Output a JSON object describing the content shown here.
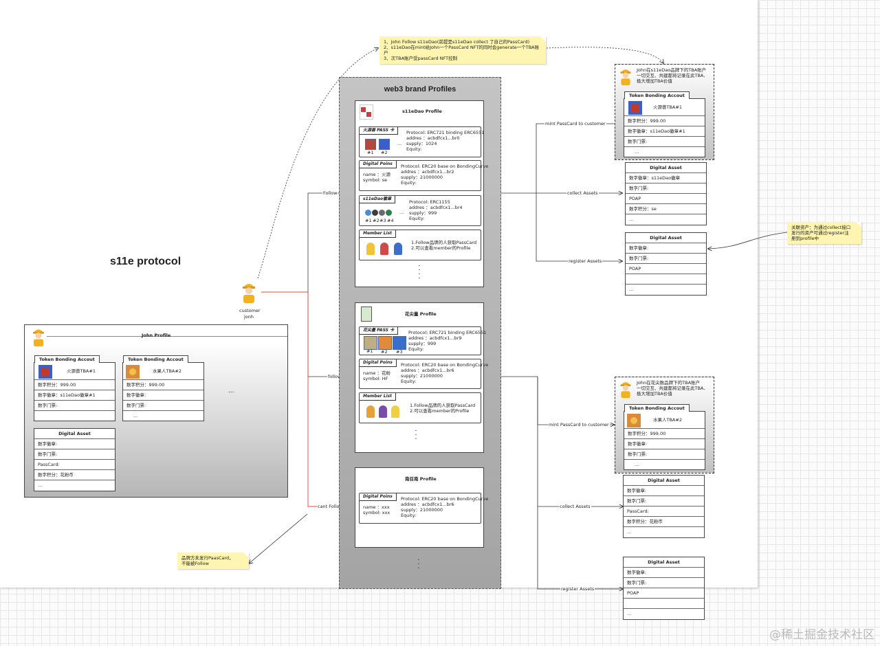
{
  "title": "s11e protocol",
  "profiles_title": "web3 brand Profiles",
  "customer": {
    "label1": "customer",
    "label2": "jonh"
  },
  "top_note": [
    "1、John Follow s11eDao(前提是s11eDao collect 了自己的PassCard)",
    "2、s11eDao在mint给John一个PassCard NFT的同时会generate一个TBA账户",
    "3、次TBA账户受passCard NFT控制"
  ],
  "bottom_note": [
    "品牌方未发行PaasCard，",
    "不能被Follow"
  ],
  "right_note": [
    "关联资产：为通过collect接口",
    "发行的资产可通过register注",
    "册到profile中"
  ],
  "edges": {
    "follow1": "Follow",
    "follow2": "follow",
    "cant": "cant Follow",
    "mint1": "mint PassCard to customer",
    "collect1": "collect Assets",
    "register1": "register Assets",
    "mint2": "mint PassCard to customer",
    "collect2": "collect Assets",
    "register2": "register Assets"
  },
  "john": {
    "title": "John Profile",
    "tba1": {
      "head": "Token Bonding Accout",
      "name": "火源兽TBA#1",
      "rows": [
        "数字积分：999.00",
        "数字徽章：s11eDao徽章#1",
        "数字门票:",
        ""
      ]
    },
    "tba2": {
      "head": "Token Bonding Accout",
      "name": "水果人TBA#2",
      "rows": [
        "数字积分：999.00",
        "数字徽章:",
        "数字门票:",
        "..."
      ]
    },
    "more": "...",
    "asset": {
      "head": "Digital Asset",
      "rows": [
        "数字徽章:",
        "数字门票:",
        "PassCard:",
        "数字积分：花粉币",
        "..."
      ]
    }
  },
  "s11e": {
    "title": "s11eDao Profile",
    "pass": {
      "tab": "火源兽 PASS 卡",
      "n1": "#1",
      "n2": "#2",
      "more": "...",
      "lines": [
        "Protocol: ERC721 binding ERC6551",
        "addres ：acbdfcx1...br0",
        "supply：1024",
        "Equity:"
      ]
    },
    "points": {
      "tab": "Digital Poins",
      "left": [
        "name ：火源",
        "symbol:  se"
      ],
      "lines": [
        "Protocol: ERC20 base on BondingCurve",
        "addres ：acbdfcx1...br2",
        "supply：21000000",
        "Equity:"
      ]
    },
    "badge": {
      "tab": "s11eDao徽章",
      "nums": [
        "#1",
        "#2",
        "#3",
        "#4"
      ],
      "more": "...",
      "lines": [
        "Protocol: ERC1155",
        "addres ：acbdfcx1...br4",
        "supply：999",
        "Equity:"
      ]
    },
    "member": {
      "tab": "Member List",
      "lines": [
        "1.Follow品牌的人获取PassCard",
        "2.可以查看member的Profile"
      ]
    }
  },
  "hua": {
    "title": "花尖量 Profile",
    "pass": {
      "tab": "花尖量 PASS 卡",
      "nums": [
        "#1",
        "#2",
        "#3"
      ],
      "lines": [
        "Protocol: ERC721 binding ERC6551",
        "addres ：acbdfcx1...br9",
        "supply：999",
        "Equity:"
      ]
    },
    "points": {
      "tab": "Digital Poins",
      "left": [
        "name ：花粉",
        "symbol:  HF"
      ],
      "lines": [
        "Protocol: ERC20 base on BondingCurve",
        "addres ：acbdfcx1...br6",
        "supply：21000000",
        "Equity:"
      ]
    },
    "member": {
      "tab": "Member List",
      "lines": [
        "1.Follow品牌的人获取PassCard",
        "2.可以查看member的Profile"
      ]
    }
  },
  "nan": {
    "title": "南召南 Profile",
    "points": {
      "tab": "Digital Poins",
      "left": [
        "name ：xxx",
        "symbol:  xxx"
      ],
      "lines": [
        "Protocol: ERC20 base on BondingCurve",
        "addres ：acbdfcx1...br6",
        "supply：21000000",
        "Equity:"
      ]
    }
  },
  "right1": {
    "note": [
      "John在s11eDao品牌下的TBA账户",
      "一切交互、共建都将记录在此TBA,",
      "极大增加TBA价值"
    ],
    "tba": {
      "head": "Token Bonding Accout",
      "name": "火源兽TBA#1",
      "rows": [
        "数字积分：999.00",
        "数字徽章：s11eDao徽章#1",
        "数字门票:",
        "..."
      ]
    },
    "asset1": {
      "head": "Digital Asset",
      "rows": [
        "数字徽章：s11eDao徽章",
        "数字门票:",
        "POAP",
        "数字积分：se",
        "..."
      ]
    },
    "asset2": {
      "head": "Digital Asset",
      "rows": [
        "数字徽章:",
        "数字门票:",
        "POAP",
        "",
        "..."
      ]
    }
  },
  "right2": {
    "note": [
      "John在花尖数品牌下的TBA账户",
      "一切交互、共建都将记录在此TBA,",
      "极大增加TBA价值"
    ],
    "tba": {
      "head": "Token Bonding Accout",
      "name": "水果人TBA#2",
      "rows": [
        "数字积分：999.00",
        "数字徽章:",
        "数字门票:",
        "..."
      ]
    },
    "asset1": {
      "head": "Digital Asset",
      "rows": [
        "数字徽章:",
        "数字门票:",
        "PassCard:",
        "数字积分：花粉币",
        "..."
      ]
    },
    "asset2": {
      "head": "Digital Asset",
      "rows": [
        "数字徽章:",
        "数字门票:",
        "POAP",
        "",
        "..."
      ]
    }
  },
  "watermark": "@稀土掘金技术社区"
}
